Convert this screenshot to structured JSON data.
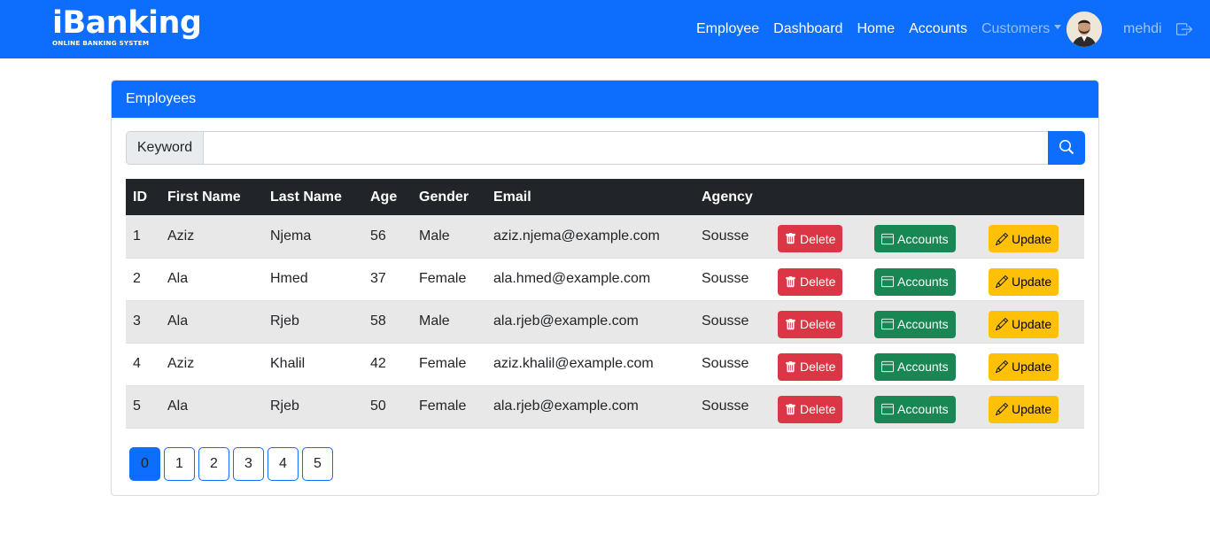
{
  "brand": {
    "name": "iBanking",
    "subtitle": "ONLINE BANKING SYSTEM"
  },
  "nav": {
    "links": [
      "Employee",
      "Dashboard",
      "Home",
      "Accounts"
    ],
    "dropdown_label": "Customers",
    "user_name": "mehdi"
  },
  "card": {
    "title": "Employees",
    "search": {
      "label": "Keyword",
      "value": "",
      "placeholder": ""
    }
  },
  "table": {
    "headers": [
      "ID",
      "First Name",
      "Last Name",
      "Age",
      "Gender",
      "Email",
      "Agency",
      "",
      "",
      ""
    ],
    "actions": {
      "delete": "Delete",
      "accounts": "Accounts",
      "update": "Update"
    },
    "rows": [
      [
        "1",
        "Aziz",
        "Njema",
        "56",
        "Male",
        "aziz.njema@example.com",
        "Sousse"
      ],
      [
        "2",
        "Ala",
        "Hmed",
        "37",
        "Female",
        "ala.hmed@example.com",
        "Sousse"
      ],
      [
        "3",
        "Ala",
        "Rjeb",
        "58",
        "Male",
        "ala.rjeb@example.com",
        "Sousse"
      ],
      [
        "4",
        "Aziz",
        "Khalil",
        "42",
        "Female",
        "aziz.khalil@example.com",
        "Sousse"
      ],
      [
        "5",
        "Ala",
        "Rjeb",
        "50",
        "Female",
        "ala.rjeb@example.com",
        "Sousse"
      ]
    ]
  },
  "pagination": {
    "pages": [
      "0",
      "1",
      "2",
      "3",
      "4",
      "5"
    ],
    "active": "0"
  },
  "icons": {
    "search": "search-icon",
    "logout": "logout-icon",
    "delete": "trash-icon",
    "accounts": "window-icon",
    "update": "pencil-icon"
  },
  "colors": {
    "primary": "#0d6efd",
    "danger": "#dc3545",
    "success": "#198754",
    "warning": "#ffc107",
    "dark": "#212529"
  }
}
